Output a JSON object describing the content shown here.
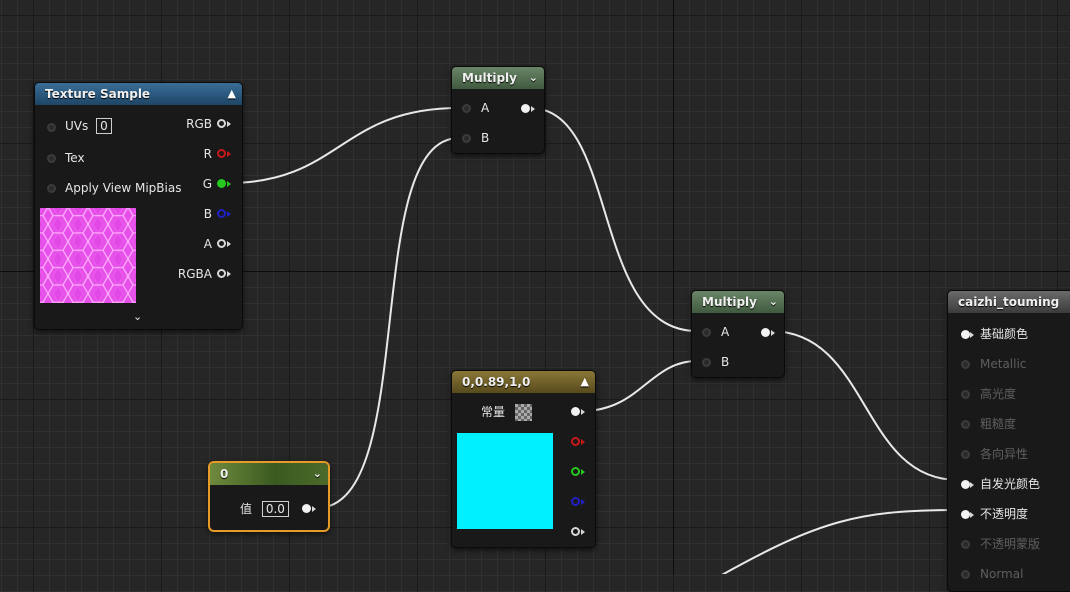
{
  "texture_sample": {
    "title": "Texture Sample",
    "inputs": {
      "uvs_label": "UVs",
      "uvs_value": "0",
      "tex_label": "Tex",
      "mip_label": "Apply View MipBias"
    },
    "outputs": [
      "RGB",
      "R",
      "G",
      "B",
      "A",
      "RGBA"
    ],
    "thumbnail_color": "#d11ad7"
  },
  "multiply_1": {
    "title": "Multiply",
    "input_a": "A",
    "input_b": "B"
  },
  "multiply_2": {
    "title": "Multiply",
    "input_a": "A",
    "input_b": "B"
  },
  "constant": {
    "title": "0,0.89,1,0",
    "param_label": "常量",
    "swatch_color": "#00f0ff"
  },
  "scalar": {
    "title": "0",
    "value_label": "值",
    "value": "0.0"
  },
  "result": {
    "title": "caizhi_touming",
    "pins": [
      {
        "label": "基础颜色",
        "active": true
      },
      {
        "label": "Metallic",
        "active": false
      },
      {
        "label": "高光度",
        "active": false
      },
      {
        "label": "粗糙度",
        "active": false
      },
      {
        "label": "各向异性",
        "active": false
      },
      {
        "label": "自发光颜色",
        "active": true
      },
      {
        "label": "不透明度",
        "active": true
      },
      {
        "label": "不透明蒙版",
        "active": false
      },
      {
        "label": "Normal",
        "active": false
      }
    ]
  },
  "colors": {
    "pin_red": "#c81818",
    "pin_green": "#27c81e",
    "pin_blue": "#2020c8",
    "selection_outline": "#e69a28"
  }
}
